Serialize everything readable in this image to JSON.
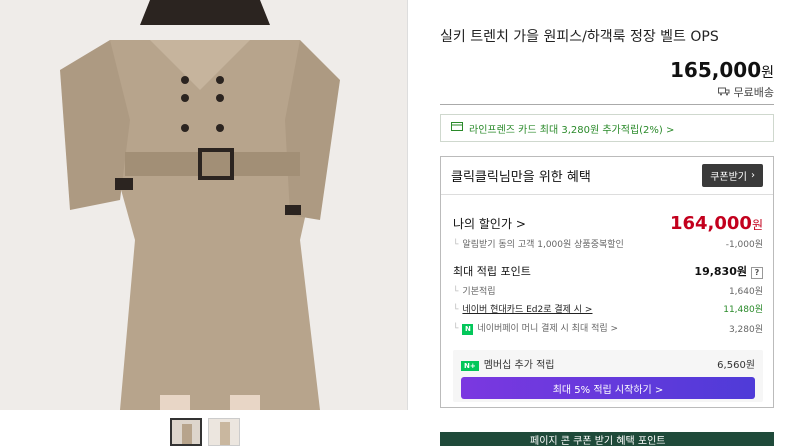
{
  "product": {
    "title": "실키 트렌치 가을 원피스/하객룩 정장 벨트 OPS",
    "price": "165,000",
    "price_unit": "원",
    "shipping": "무료배송"
  },
  "card_promo": {
    "text": "라인프렌즈 카드 최대 3,280원 추가적립(2%) >"
  },
  "benefit": {
    "title": "클릭클릭님만을 위한 혜택",
    "coupon_button": "쿠폰받기",
    "discount_label": "나의 할인가 >",
    "discount_price": "164,000",
    "discount_unit": "원",
    "discount_detail": "알림받기 동의 고객 1,000원 상품중복할인",
    "discount_detail_value": "-1,000원",
    "points_label": "최대 적립 포인트",
    "points_value": "19,830원",
    "help": "?",
    "basic_label": "기본적립",
    "basic_value": "1,640원",
    "card_label": "네이버 현대카드 Ed2로 결제 시 >",
    "card_value": "11,480원",
    "npay_label": "네이버페이 머니 결제 시 최대 적립 >",
    "npay_value": "3,280원",
    "npay_badge": "N",
    "membership_badge": "N+",
    "membership_label": "멤버십 추가 적립",
    "membership_value": "6,560원",
    "membership_button": "최대 5% 적립 시작하기 >"
  },
  "banner": {
    "text": "페이지 콘 쿠폰 받기 혜택 포인트"
  },
  "icons": {
    "shipping": "truck-icon",
    "card": "card-icon",
    "coupon": "chevron-right-icon"
  }
}
